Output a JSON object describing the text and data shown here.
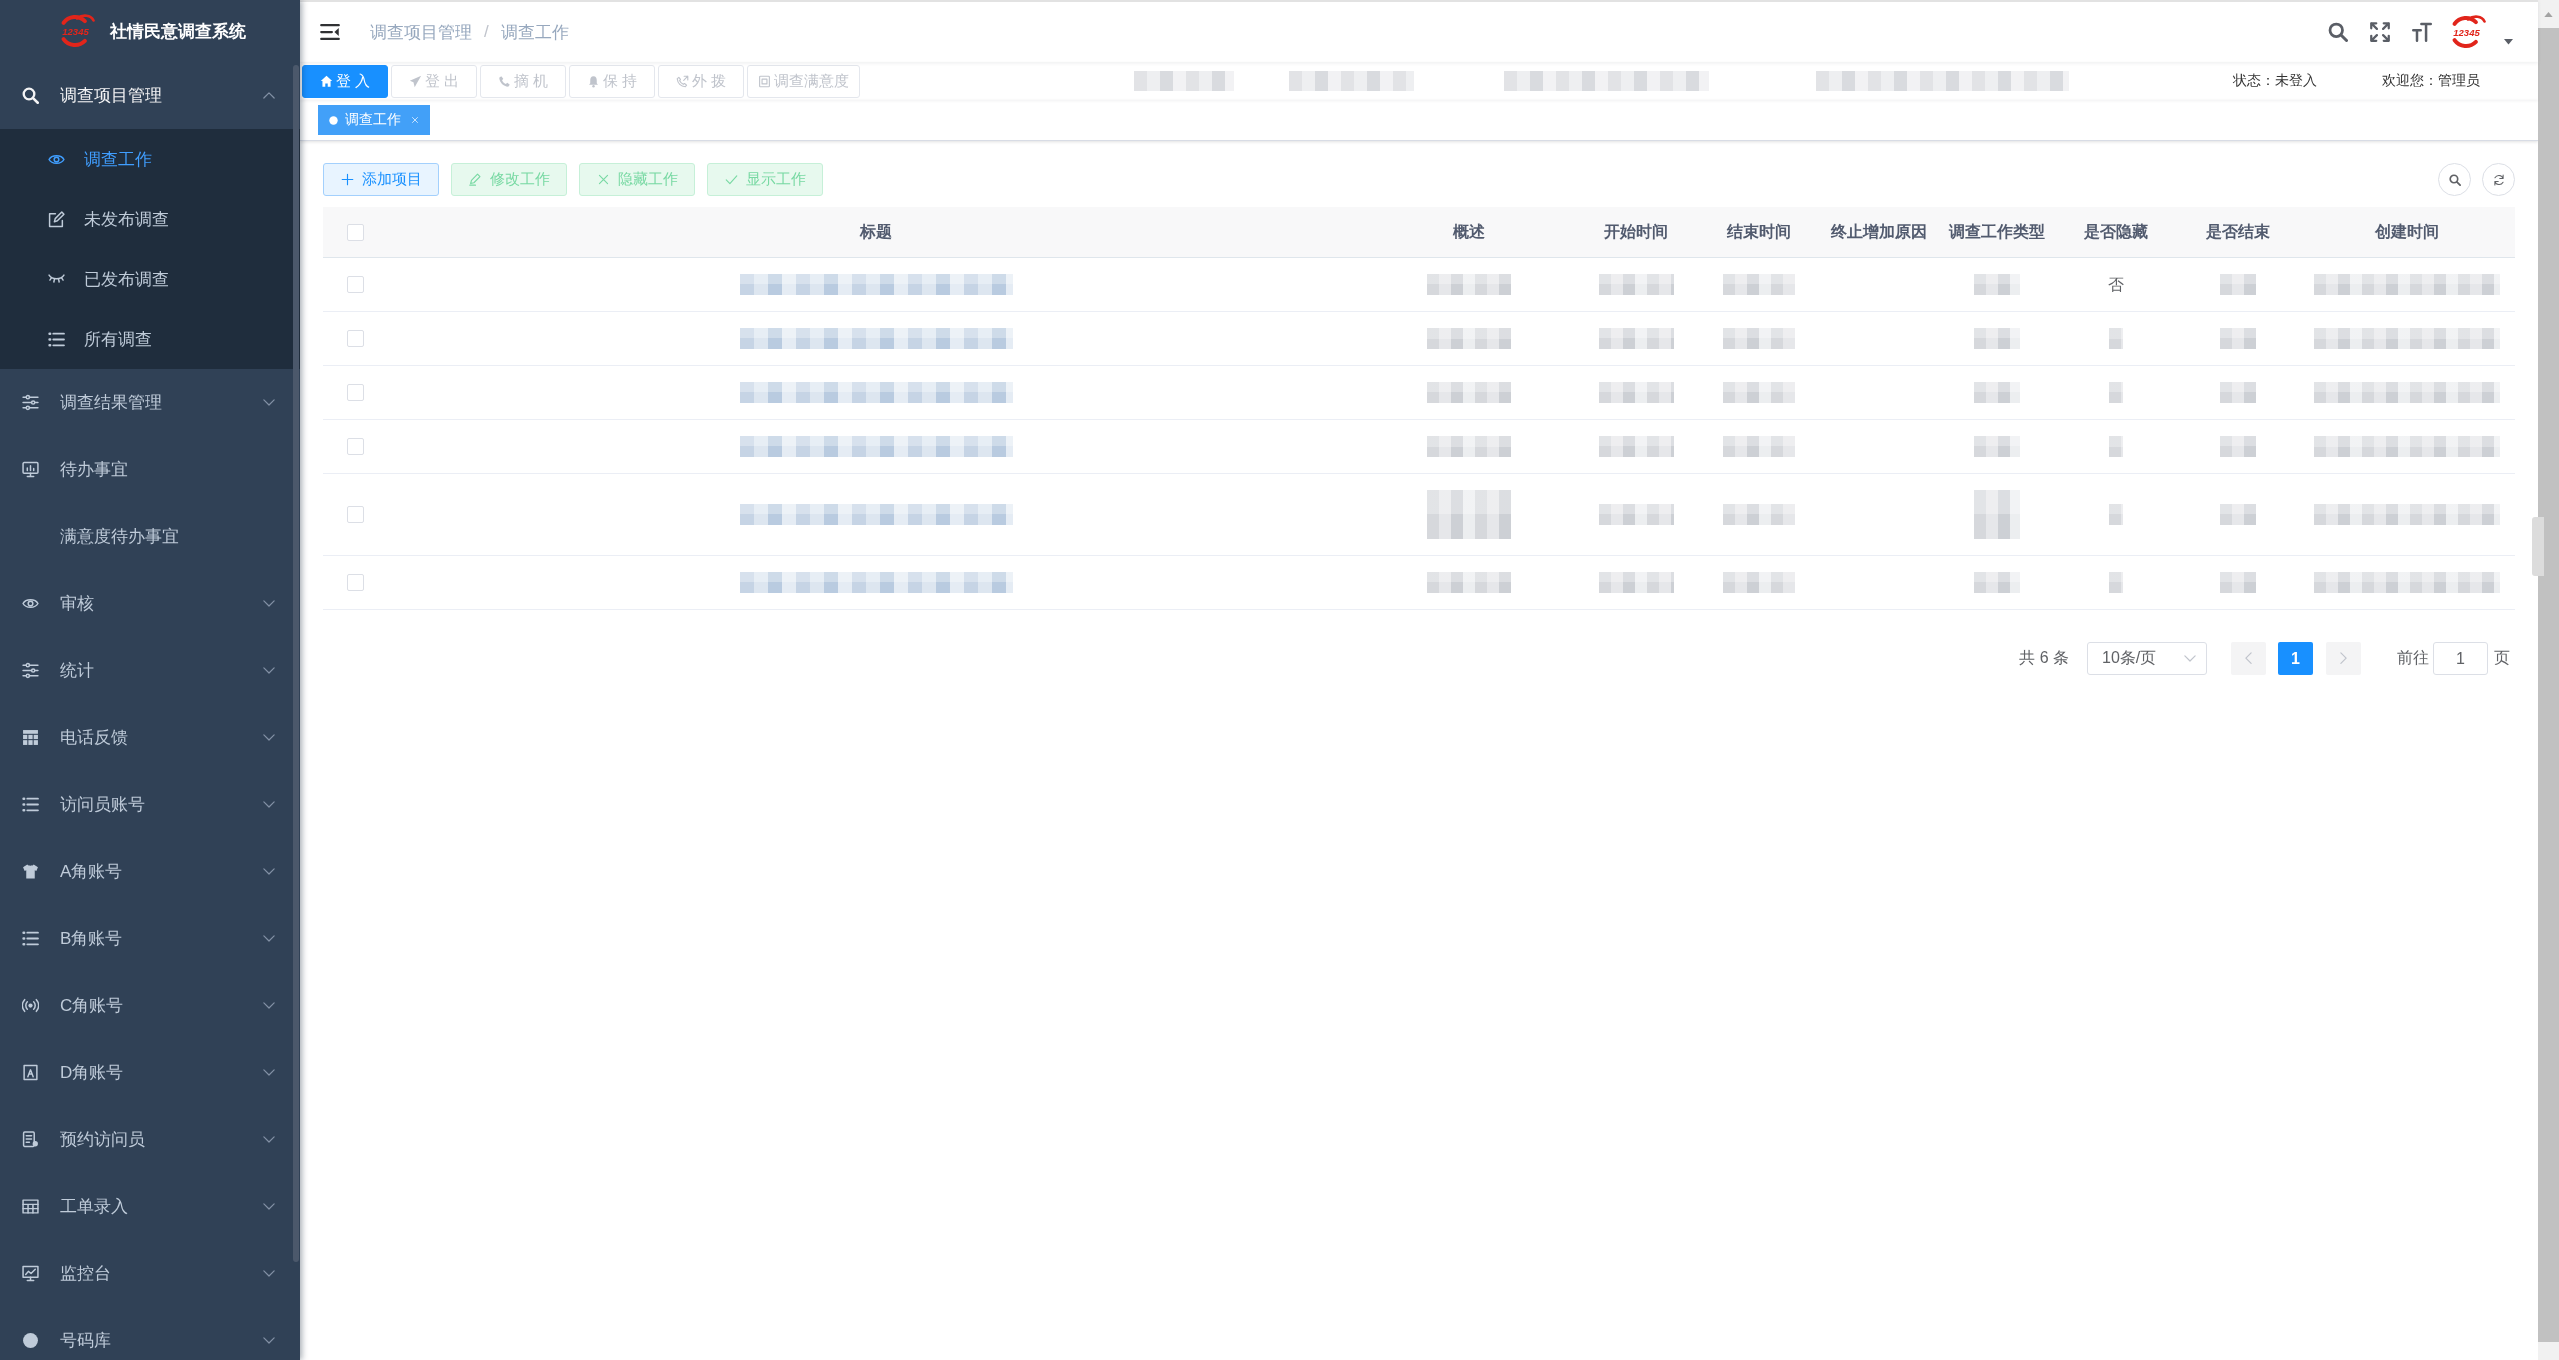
{
  "sidebar": {
    "logo_text": "12345",
    "title": "社情民意调查系统",
    "items": [
      {
        "label": "调查项目管理",
        "selected": false,
        "expanded": true,
        "children": [
          {
            "label": "调查工作",
            "selected": true
          },
          {
            "label": "未发布调查",
            "selected": false
          },
          {
            "label": "已发布调查",
            "selected": false
          },
          {
            "label": "所有调查",
            "selected": false
          }
        ]
      },
      {
        "label": "调查结果管理",
        "selected": false,
        "expanded": false
      },
      {
        "label": "待办事宜",
        "selected": false
      },
      {
        "label": "满意度待办事宜",
        "selected": false
      },
      {
        "label": "审核",
        "selected": false,
        "expanded": false
      },
      {
        "label": "统计",
        "selected": false,
        "expanded": false
      },
      {
        "label": "电话反馈",
        "selected": false,
        "expanded": false
      },
      {
        "label": "访问员账号",
        "selected": false,
        "expanded": false
      },
      {
        "label": "A角账号",
        "selected": false,
        "expanded": false
      },
      {
        "label": "B角账号",
        "selected": false,
        "expanded": false
      },
      {
        "label": "C角账号",
        "selected": false,
        "expanded": false
      },
      {
        "label": "D角账号",
        "selected": false,
        "expanded": false
      },
      {
        "label": "预约访问员",
        "selected": false,
        "expanded": false
      },
      {
        "label": "工单录入",
        "selected": false,
        "expanded": false
      },
      {
        "label": "监控台",
        "selected": false,
        "expanded": false
      },
      {
        "label": "号码库",
        "selected": false,
        "expanded": false
      }
    ]
  },
  "navbar": {
    "breadcrumb": {
      "items": [
        "调查项目管理",
        "调查工作"
      ],
      "separator": "/"
    },
    "avatar_text": "12345"
  },
  "phone_bar": {
    "buttons": [
      {
        "label": "登 入",
        "disabled": false
      },
      {
        "label": "登 出",
        "disabled": true
      },
      {
        "label": "摘 机",
        "disabled": true
      },
      {
        "label": "保 持",
        "disabled": true
      },
      {
        "label": "外 拨",
        "disabled": true
      },
      {
        "label": "调查满意度",
        "disabled": true
      }
    ],
    "masked_fields": [
      {
        "kind": "blur"
      },
      {
        "kind": "blur"
      },
      {
        "kind": "blur"
      },
      {
        "kind": "blur"
      }
    ],
    "status": "状态：未登入",
    "welcome": "欢迎您：管理员"
  },
  "tags": [
    {
      "label": "调查工作",
      "selected": true
    }
  ],
  "actions": [
    {
      "label": "添加项目",
      "kind": "primary",
      "disabled": false
    },
    {
      "label": "修改工作",
      "kind": "success",
      "disabled": true
    },
    {
      "label": "隐藏工作",
      "kind": "success",
      "disabled": true
    },
    {
      "label": "显示工作",
      "kind": "success",
      "disabled": true
    }
  ],
  "table": {
    "header_checked": false,
    "columns": [
      "标题",
      "概述",
      "开始时间",
      "结束时间",
      "终止增加原因",
      "调查工作类型",
      "是否隐藏",
      "是否结束",
      "创建时间"
    ],
    "rows": [
      {
        "checked": false,
        "cells": [
          {
            "kind": "blur"
          },
          {
            "kind": "blur"
          },
          {
            "kind": "blur"
          },
          {
            "kind": "blur"
          },
          {
            "kind": "blank"
          },
          {
            "kind": "blur"
          },
          {
            "kind": "text",
            "text": "否"
          },
          {
            "kind": "blur"
          },
          {
            "kind": "blur"
          }
        ]
      },
      {
        "checked": false,
        "cells": [
          {
            "kind": "blur"
          },
          {
            "kind": "blur"
          },
          {
            "kind": "blur"
          },
          {
            "kind": "blur"
          },
          {
            "kind": "blank"
          },
          {
            "kind": "blur"
          },
          {
            "kind": "blur"
          },
          {
            "kind": "blur"
          },
          {
            "kind": "blur"
          }
        ]
      },
      {
        "checked": false,
        "cells": [
          {
            "kind": "blur"
          },
          {
            "kind": "blur"
          },
          {
            "kind": "blur"
          },
          {
            "kind": "blur"
          },
          {
            "kind": "blank"
          },
          {
            "kind": "blur"
          },
          {
            "kind": "blur"
          },
          {
            "kind": "blur"
          },
          {
            "kind": "blur"
          }
        ]
      },
      {
        "checked": false,
        "cells": [
          {
            "kind": "blur"
          },
          {
            "kind": "blur"
          },
          {
            "kind": "blur"
          },
          {
            "kind": "blur"
          },
          {
            "kind": "blank"
          },
          {
            "kind": "blur"
          },
          {
            "kind": "blur"
          },
          {
            "kind": "blur"
          },
          {
            "kind": "blur"
          }
        ]
      },
      {
        "checked": false,
        "cells": [
          {
            "kind": "blur"
          },
          {
            "kind": "blur2"
          },
          {
            "kind": "blur"
          },
          {
            "kind": "blur"
          },
          {
            "kind": "blank"
          },
          {
            "kind": "blur2"
          },
          {
            "kind": "blur"
          },
          {
            "kind": "blur"
          },
          {
            "kind": "blur"
          }
        ]
      },
      {
        "checked": false,
        "cells": [
          {
            "kind": "blur"
          },
          {
            "kind": "blur"
          },
          {
            "kind": "blur"
          },
          {
            "kind": "blur"
          },
          {
            "kind": "blank"
          },
          {
            "kind": "blur"
          },
          {
            "kind": "blur"
          },
          {
            "kind": "blur"
          },
          {
            "kind": "blur"
          }
        ]
      }
    ]
  },
  "pagination": {
    "total": "共 6 条",
    "page_size": "10条/页",
    "prev_disabled": true,
    "pages": [
      {
        "label": "1",
        "selected": true
      }
    ],
    "next_disabled": true,
    "goto_label": "前往",
    "goto_value": "1",
    "page_suffix": "页"
  }
}
